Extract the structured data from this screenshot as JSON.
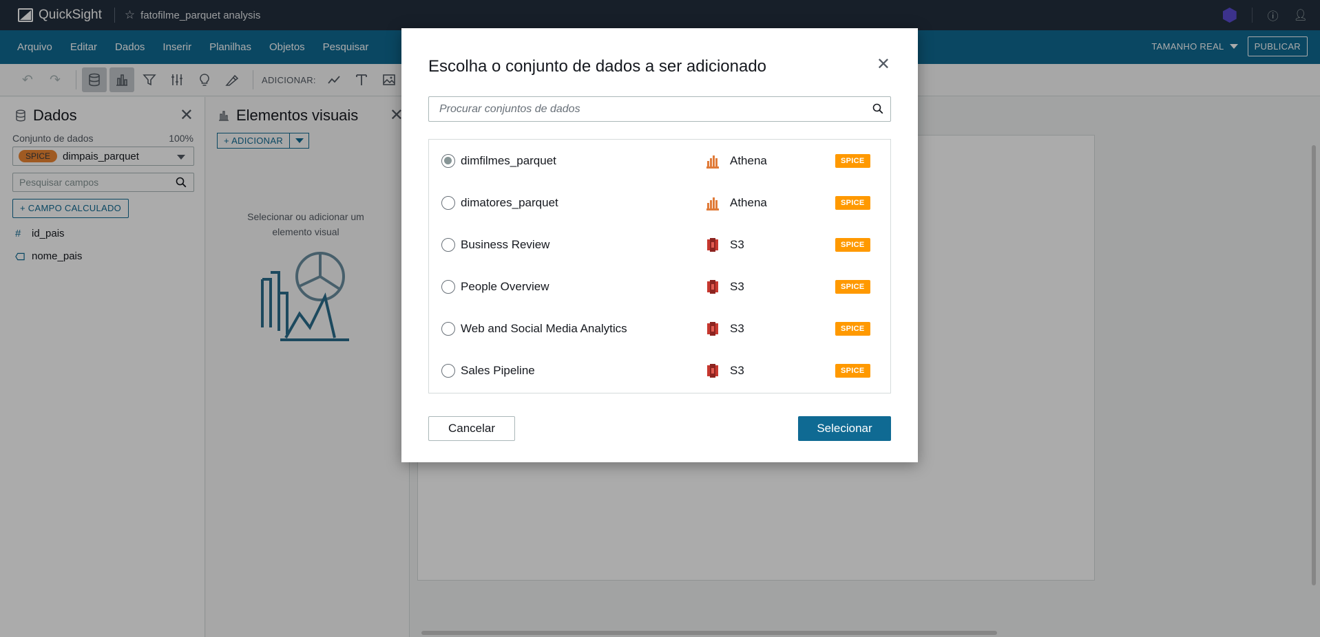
{
  "app": {
    "name": "QuickSight",
    "analysis_title": "fatofilme_parquet analysis"
  },
  "menu": [
    "Arquivo",
    "Editar",
    "Dados",
    "Inserir",
    "Planilhas",
    "Objetos",
    "Pesquisar"
  ],
  "menubar_right": {
    "size_label": "TAMANHO REAL",
    "publish_label": "PUBLICAR"
  },
  "toolbar": {
    "add_label": "ADICIONAR:"
  },
  "data_panel": {
    "title": "Dados",
    "dataset_label": "Conjunto de dados",
    "dataset_percent": "100%",
    "dataset_badge": "SPICE",
    "dataset_name": "dimpais_parquet",
    "field_search_placeholder": "Pesquisar campos",
    "calc_field_label": "+  CAMPO CALCULADO",
    "fields": [
      {
        "name": "id_pais",
        "icon": "hash-icon"
      },
      {
        "name": "nome_pais",
        "icon": "tag-icon"
      }
    ]
  },
  "visuals_panel": {
    "title": "Elementos visuais",
    "add_label": "+ ADICIONAR",
    "hint": "Selecionar ou adicionar um elemento visual"
  },
  "dialog": {
    "title": "Escolha o conjunto de dados a ser adicionado",
    "search_placeholder": "Procurar conjuntos de dados",
    "datasets": [
      {
        "name": "dimfilmes_parquet",
        "source": "Athena",
        "source_icon": "athena-icon",
        "badge": "SPICE",
        "selected": true
      },
      {
        "name": "dimatores_parquet",
        "source": "Athena",
        "source_icon": "athena-icon",
        "badge": "SPICE",
        "selected": false
      },
      {
        "name": "Business Review",
        "source": "S3",
        "source_icon": "s3-icon",
        "badge": "SPICE",
        "selected": false
      },
      {
        "name": "People Overview",
        "source": "S3",
        "source_icon": "s3-icon",
        "badge": "SPICE",
        "selected": false
      },
      {
        "name": "Web and Social Media Analytics",
        "source": "S3",
        "source_icon": "s3-icon",
        "badge": "SPICE",
        "selected": false
      },
      {
        "name": "Sales Pipeline",
        "source": "S3",
        "source_icon": "s3-icon",
        "badge": "SPICE",
        "selected": false
      }
    ],
    "cancel_label": "Cancelar",
    "select_label": "Selecionar"
  },
  "colors": {
    "topbar": "#232f3e",
    "menubar": "#0f6a93",
    "spice_badge": "#ff9900",
    "primary_button": "#0f6a93"
  }
}
